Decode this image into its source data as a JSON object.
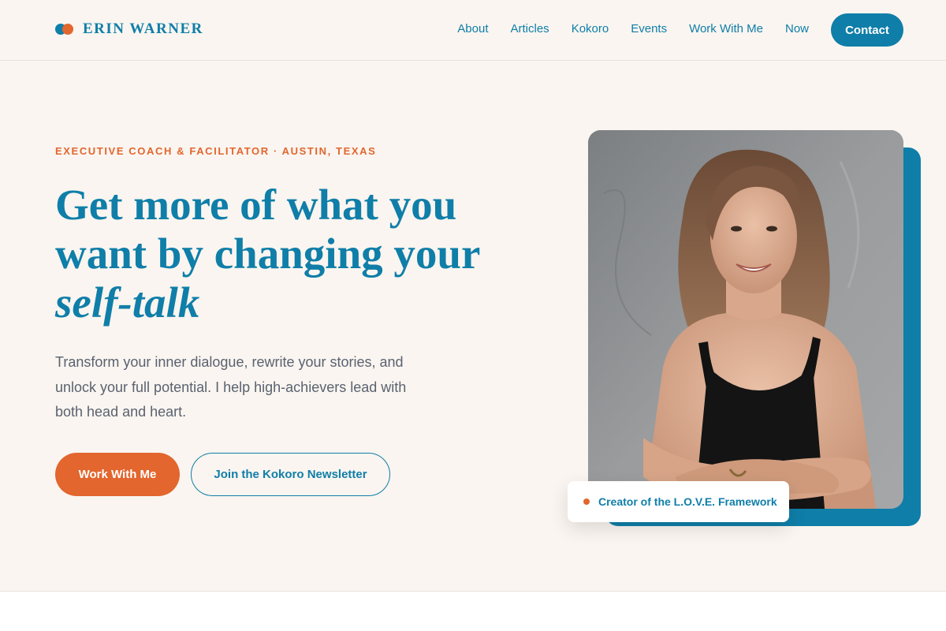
{
  "header": {
    "brand": "ERIN WARNER",
    "nav": [
      {
        "label": "About"
      },
      {
        "label": "Articles"
      },
      {
        "label": "Kokoro"
      },
      {
        "label": "Events"
      },
      {
        "label": "Work With Me"
      },
      {
        "label": "Now"
      }
    ],
    "contact_label": "Contact"
  },
  "hero": {
    "eyebrow": "EXECUTIVE COACH & FACILITATOR · AUSTIN, TEXAS",
    "headline_main": "Get more of what you want by changing your ",
    "headline_emphasis": "self-talk",
    "lede": "Transform your inner dialogue, rewrite your stories, and unlock your full potential. I help high-achievers lead with both head and heart.",
    "primary_cta": "Work With Me",
    "secondary_cta": "Join the Kokoro Newsletter",
    "badge": "Creator of the L.O.V.E. Framework"
  },
  "colors": {
    "brand_blue": "#0f7ea8",
    "accent_orange": "#e2662e",
    "background": "#faf5f0",
    "body_text": "#5a6270"
  }
}
